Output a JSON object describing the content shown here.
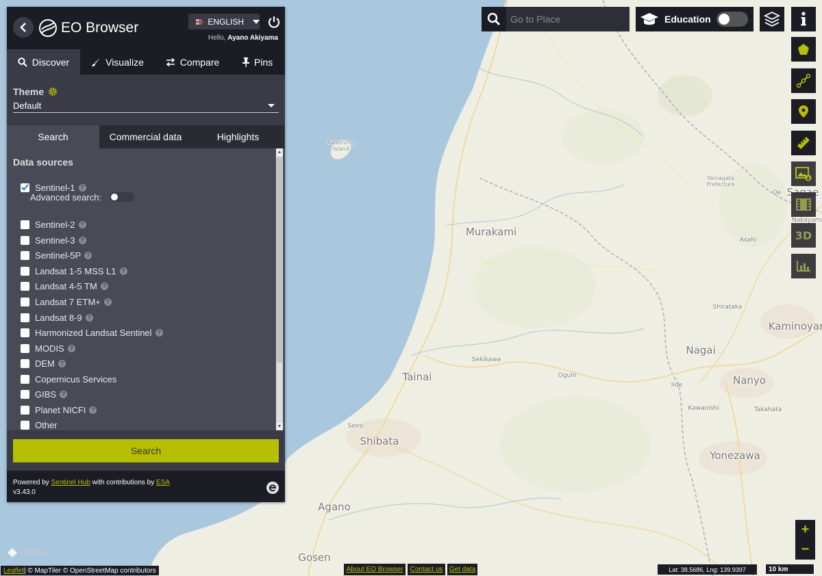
{
  "header": {
    "app_title": "EO Browser",
    "language": "ENGLISH",
    "hello_prefix": "Hello,",
    "user_name": "Ayano Akiyama"
  },
  "main_tabs": [
    {
      "label": "Discover",
      "icon": "search-icon",
      "active": true
    },
    {
      "label": "Visualize",
      "icon": "brush-icon",
      "active": false
    },
    {
      "label": "Compare",
      "icon": "compare-arrows-icon",
      "active": false
    },
    {
      "label": "Pins",
      "icon": "pin-icon",
      "active": false
    }
  ],
  "theme": {
    "label": "Theme",
    "value": "Default"
  },
  "sub_tabs": [
    {
      "label": "Search",
      "active": true
    },
    {
      "label": "Commercial data",
      "active": false
    },
    {
      "label": "Highlights",
      "active": false
    }
  ],
  "data_sources": {
    "title": "Data sources",
    "advanced_search_label": "Advanced search:",
    "items": [
      {
        "label": "Sentinel-1",
        "checked": true
      },
      {
        "label": "Sentinel-2",
        "checked": false
      },
      {
        "label": "Sentinel-3",
        "checked": false
      },
      {
        "label": "Sentinel-5P",
        "checked": false
      },
      {
        "label": "Landsat 1-5 MSS L1",
        "checked": false
      },
      {
        "label": "Landsat 4-5 TM",
        "checked": false
      },
      {
        "label": "Landsat 7 ETM+",
        "checked": false
      },
      {
        "label": "Landsat 8-9",
        "checked": false
      },
      {
        "label": "Harmonized Landsat Sentinel",
        "checked": false
      },
      {
        "label": "MODIS",
        "checked": false
      },
      {
        "label": "DEM",
        "checked": false
      },
      {
        "label": "Copernicus Services",
        "checked": false
      },
      {
        "label": "GIBS",
        "checked": false
      },
      {
        "label": "Planet NICFI",
        "checked": false
      },
      {
        "label": "Other",
        "checked": false
      }
    ]
  },
  "search_button": "Search",
  "footer": {
    "powered_by": "Powered by",
    "sentinel_hub": "Sentinel Hub",
    "contributions": "with contributions by",
    "esa": "ESA",
    "version": "v3.43.0"
  },
  "top_bar": {
    "place_placeholder": "Go to Place",
    "education_label": "Education"
  },
  "map": {
    "labels": {
      "awashima": "Awashima\nIsland",
      "murakami": "Murakami",
      "yamagata": "Yamagata\nPrefecture",
      "asahi": "Asahi",
      "shirataka": "Shirataka",
      "kaminoyama": "Kaminoyar",
      "nagai": "Nagai",
      "nanyo": "Nanyo",
      "sekikawa": "Sekikawa",
      "oguni": "Oguni",
      "iide": "Iide",
      "kawanishi": "Kawanishi",
      "takahata": "Takahata",
      "tainai": "Tainai",
      "seiro": "Seiro",
      "shibata": "Shibata",
      "yonezawa": "Yonezawa",
      "agano": "Agano",
      "gosen": "Gosen",
      "sagae": "Sagae",
      "oe": "Oe",
      "nakayama": "Nakayama"
    }
  },
  "bottom_bar": {
    "leaflet": "Leaflet",
    "attribution_rest": " | © MapTiler © OpenStreetMap contributors",
    "about": "About EO Browser",
    "contact": "Contact us",
    "get_data": "Get data",
    "latlng": "Lat: 38.5686, Lng: 139.9397",
    "scale": "10 km",
    "maptiler": "maptiler"
  },
  "zoom": {
    "in": "+",
    "out": "−"
  },
  "colors": {
    "accent": "#b6bf00",
    "panel_dark": "#1c1c24",
    "panel": "#3b3b48",
    "water": "#a9c7dd",
    "land": "#eeefe2"
  }
}
